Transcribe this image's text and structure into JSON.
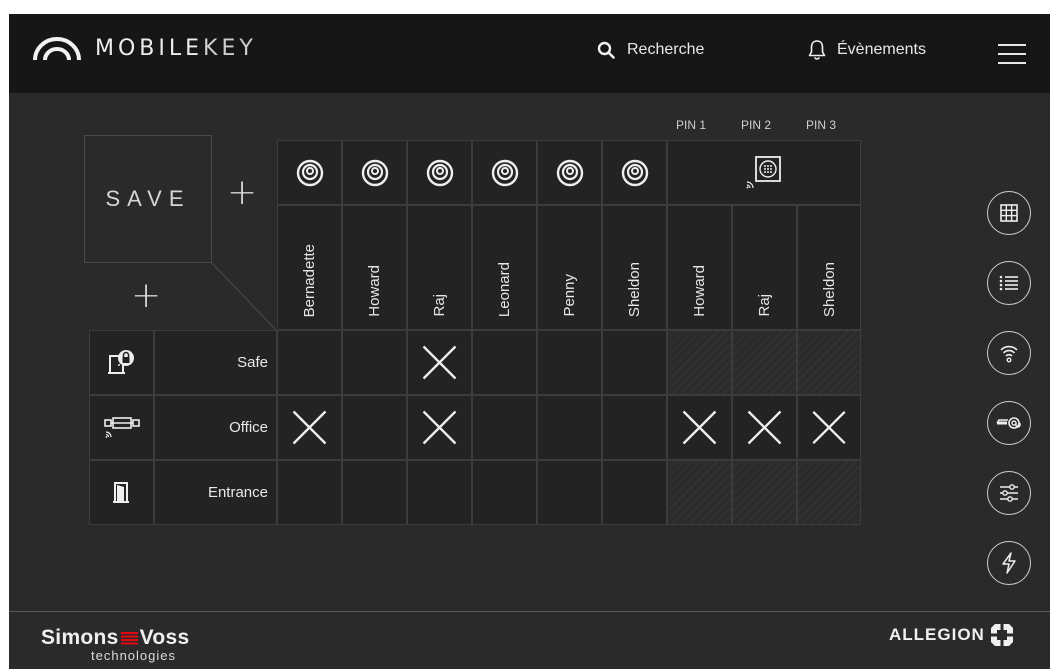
{
  "header": {
    "logo_text_bold": "MOBILE",
    "logo_text_light": "KEY",
    "search_label": "Recherche",
    "events_label": "Évènements"
  },
  "matrix": {
    "save_label": "SAVE",
    "pin_labels": [
      "PIN 1",
      "PIN 2",
      "PIN 3"
    ],
    "transponder_users": [
      "Bernadette",
      "Howard",
      "Raj",
      "Leonard",
      "Penny",
      "Sheldon"
    ],
    "pin_users": [
      "Howard",
      "Raj",
      "Sheldon"
    ],
    "doors": [
      {
        "name": "Safe",
        "icon": "safe-door-lock-icon",
        "pin_available": false,
        "access": [
          false,
          false,
          true,
          false,
          false,
          false
        ]
      },
      {
        "name": "Office",
        "icon": "cylinder-lock-icon",
        "pin_available": true,
        "access": [
          true,
          false,
          true,
          false,
          false,
          false,
          true,
          true,
          true
        ]
      },
      {
        "name": "Entrance",
        "icon": "door-icon",
        "pin_available": false,
        "access": [
          false,
          false,
          false,
          false,
          false,
          false
        ]
      }
    ]
  },
  "sidebar": {
    "buttons": [
      "matrix-view-icon",
      "list-view-icon",
      "wireless-icon",
      "email-key-icon",
      "settings-sliders-icon",
      "power-icon"
    ]
  },
  "footer": {
    "simonsvoss_left": "Simons",
    "simonsvoss_right": "Voss",
    "simonsvoss_sub": "technologies",
    "allegion": "ALLEGION"
  },
  "colors": {
    "background": "#2a2a2a",
    "header": "#161616",
    "accent_red": "#e30613"
  }
}
